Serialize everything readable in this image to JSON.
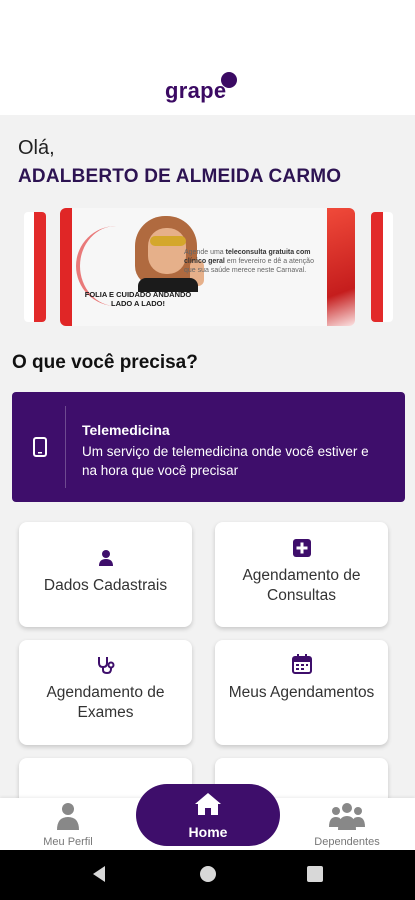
{
  "header": {
    "logo_text": "grape"
  },
  "greeting": "Olá,",
  "user_name": "ADALBERTO DE ALMEIDA CARMO",
  "banner": {
    "text_prefix": "Agende uma ",
    "text_bold": "teleconsulta gratuita com clínico geral",
    "text_suffix": " em fevereiro e dê a atenção que sua saúde merece neste Carnaval.",
    "slogan": "FOLIA E CUIDADO ANDANDO LADO A LADO!",
    "accent_color": "#e02626"
  },
  "section_title": "O que você precisa?",
  "telemedicina": {
    "title": "Telemedicina",
    "description": "Um serviço de telemedicina onde você estiver e na hora que você precisar",
    "icon": "phone-icon",
    "color": "#3e0e6b"
  },
  "cards": [
    {
      "label": "Dados Cadastrais",
      "icon": "user-icon"
    },
    {
      "label": "Agendamento de Consultas",
      "icon": "plus-square-icon"
    },
    {
      "label": "Agendamento de Exames",
      "icon": "stethoscope-icon"
    },
    {
      "label": "Meus Agendamentos",
      "icon": "calendar-icon"
    }
  ],
  "bottom_nav": {
    "profile": "Meu Perfil",
    "home": "Home",
    "dependents": "Dependentes"
  },
  "colors": {
    "brand": "#3e0e6b",
    "background": "#f2f2f2"
  }
}
